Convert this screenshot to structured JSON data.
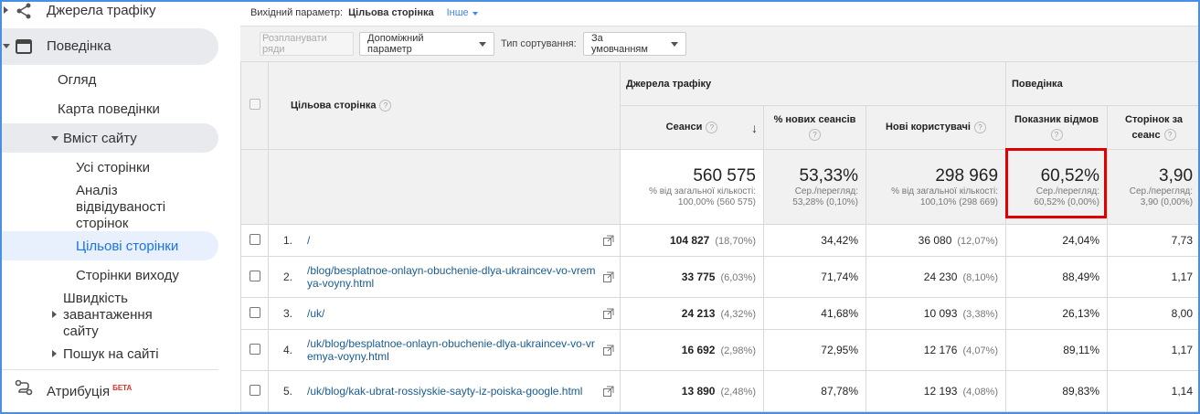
{
  "sidebar": {
    "traffic_sources": "Джерела трафіку",
    "behavior": "Поведінка",
    "overview": "Огляд",
    "behavior_map": "Карта поведінки",
    "site_content": "Вміст сайту",
    "all_pages": "Усі сторінки",
    "drilldown": [
      "Аналіз",
      "відвідуваності",
      "сторінок"
    ],
    "landing_pages": "Цільові сторінки",
    "exit_pages": "Сторінки виходу",
    "site_speed": [
      "Швидкість",
      "завантаження",
      "сайту"
    ],
    "site_search": "Пошук на сайті",
    "attribution": "Атрибуція",
    "beta": "БЕТА"
  },
  "primary_dimension": {
    "label": "Вихідний параметр:",
    "value": "Цільова сторінка",
    "other": "Інше"
  },
  "toolbar": {
    "plot_rows": "Розпланувати ряди",
    "secondary_dimension": "Допоміжний параметр",
    "sort_type_label": "Тип сортування:",
    "sort_type_value": "За умовчанням"
  },
  "table": {
    "dimension_header": "Цільова сторінка",
    "group_acquisition": "Джерела трафіку",
    "group_behavior": "Поведінка",
    "columns": {
      "sessions": "Сеанси",
      "new_sessions": "% нових сеансів",
      "new_users": "Нові користувачі",
      "bounce_rate": "Показник відмов",
      "pages_per_session": "Сторінок за сеанс"
    },
    "totals": {
      "sessions": {
        "value": "560 575",
        "sub1": "% від загальної кількості:",
        "sub2": "100,00% (560 575)"
      },
      "new_sessions": {
        "value": "53,33%",
        "sub1": "Сер./перегляд:",
        "sub2": "53,28% (0,10%)"
      },
      "new_users": {
        "value": "298 969",
        "sub1": "% від загальної кількості:",
        "sub2": "100,10% (298 669)"
      },
      "bounce_rate": {
        "value": "60,52%",
        "sub1": "Сер./перегляд:",
        "sub2": "60,52% (0,00%)"
      },
      "pages_per_session": {
        "value": "3,90",
        "sub1": "Сер./перегляд:",
        "sub2": "3,90 (0,00%)"
      }
    },
    "rows": [
      {
        "n": "1.",
        "page": "/",
        "sessions": "104 827",
        "sessions_pct": "(18,70%)",
        "new_sessions": "34,42%",
        "new_users": "36 080",
        "new_users_pct": "(12,07%)",
        "bounce": "24,04%",
        "pps": "7,73"
      },
      {
        "n": "2.",
        "page": "/blog/besplatnoe-onlayn-obuchenie-dlya-ukraincev-vo-vremya-voyny.html",
        "sessions": "33 775",
        "sessions_pct": "(6,03%)",
        "new_sessions": "71,74%",
        "new_users": "24 230",
        "new_users_pct": "(8,10%)",
        "bounce": "88,49%",
        "pps": "1,17"
      },
      {
        "n": "3.",
        "page": "/uk/",
        "sessions": "24 213",
        "sessions_pct": "(4,32%)",
        "new_sessions": "41,68%",
        "new_users": "10 093",
        "new_users_pct": "(3,38%)",
        "bounce": "26,13%",
        "pps": "8,00"
      },
      {
        "n": "4.",
        "page": "/uk/blog/besplatnoe-onlayn-obuchenie-dlya-ukraincev-vo-vremya-voyny.html",
        "sessions": "16 692",
        "sessions_pct": "(2,98%)",
        "new_sessions": "72,95%",
        "new_users": "12 176",
        "new_users_pct": "(4,07%)",
        "bounce": "89,11%",
        "pps": "1,17"
      },
      {
        "n": "5.",
        "page": "/uk/blog/kak-ubrat-rossiyskie-sayty-iz-poiska-google.html",
        "sessions": "13 890",
        "sessions_pct": "(2,48%)",
        "new_sessions": "87,78%",
        "new_users": "12 193",
        "new_users_pct": "(4,08%)",
        "bounce": "89,83%",
        "pps": "1,14"
      }
    ]
  },
  "colors": {
    "accent_link": "#1a5b8f",
    "highlight": "#e00000",
    "active_nav": "#1a73e8"
  }
}
